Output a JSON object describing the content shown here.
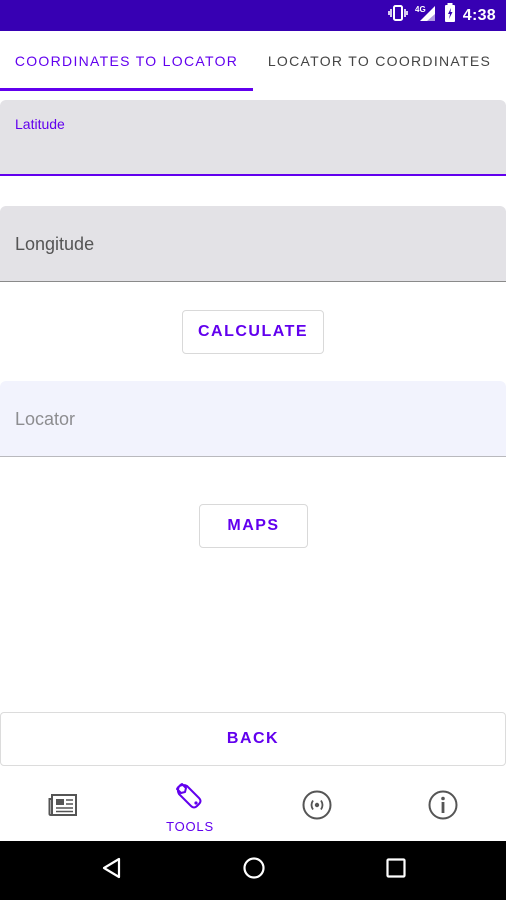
{
  "status_bar": {
    "time": "4:38",
    "network": "4G",
    "icons": [
      "vibrate-icon",
      "signal-icon",
      "battery-icon"
    ]
  },
  "tabs": [
    {
      "label": "Coordinates to Locator",
      "selected": true
    },
    {
      "label": "Locator to Coordinates",
      "selected": false
    }
  ],
  "form": {
    "latitude": {
      "label": "Latitude",
      "value": ""
    },
    "longitude": {
      "label": "Longitude",
      "value": ""
    },
    "calculate_label": "Calculate",
    "locator": {
      "label": "Locator",
      "value": ""
    },
    "maps_label": "Maps"
  },
  "back_label": "Back",
  "bottom_nav": [
    {
      "icon": "news-icon",
      "label": ""
    },
    {
      "icon": "wrench-icon",
      "label": "Tools",
      "selected": true
    },
    {
      "icon": "broadcast-icon",
      "label": ""
    },
    {
      "icon": "info-icon",
      "label": ""
    }
  ],
  "colors": {
    "primary": "#6200ee",
    "status_bar": "#3700b3",
    "field_fill": "#e3e2e6",
    "locator_fill": "#f2f3fd"
  }
}
